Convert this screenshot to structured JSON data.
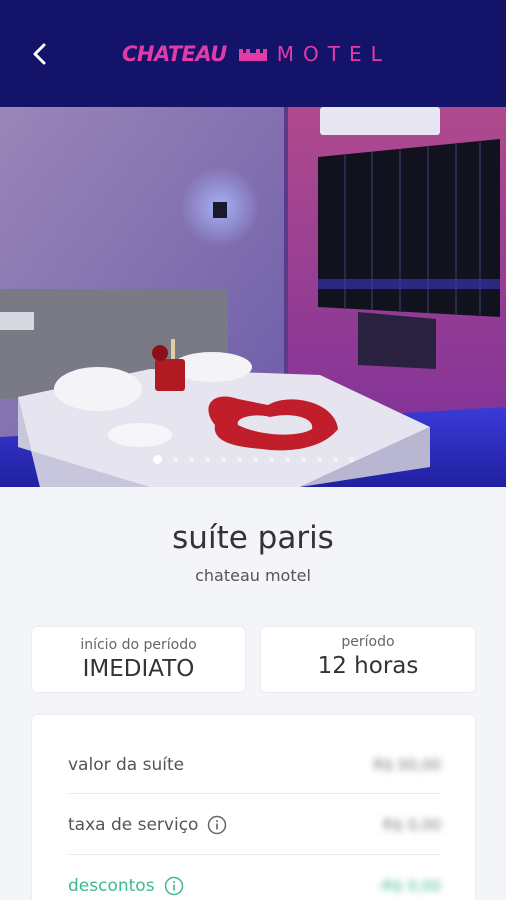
{
  "header": {
    "logo_primary": "CHATEAU",
    "logo_secondary": "MOTEL",
    "logo_color": "#e23ba8",
    "background": "#13136a",
    "back_icon": "chevron-left-icon"
  },
  "gallery": {
    "photo_count": 13,
    "active_index": 0
  },
  "suite": {
    "name": "suíte paris",
    "motel": "chateau motel"
  },
  "period": {
    "start_label": "início do período",
    "start_value": "IMEDIATO",
    "duration_label": "período",
    "duration_value": "12 horas"
  },
  "pricing": {
    "rows": [
      {
        "label": "valor da suíte",
        "value": "R$ 00,00",
        "info": false
      },
      {
        "label": "taxa de serviço",
        "value": "R$ 0,00",
        "info": true
      },
      {
        "label": "descontos",
        "value": "-R$ 0,00",
        "info": true
      }
    ],
    "discount_color": "#3fb98a"
  }
}
